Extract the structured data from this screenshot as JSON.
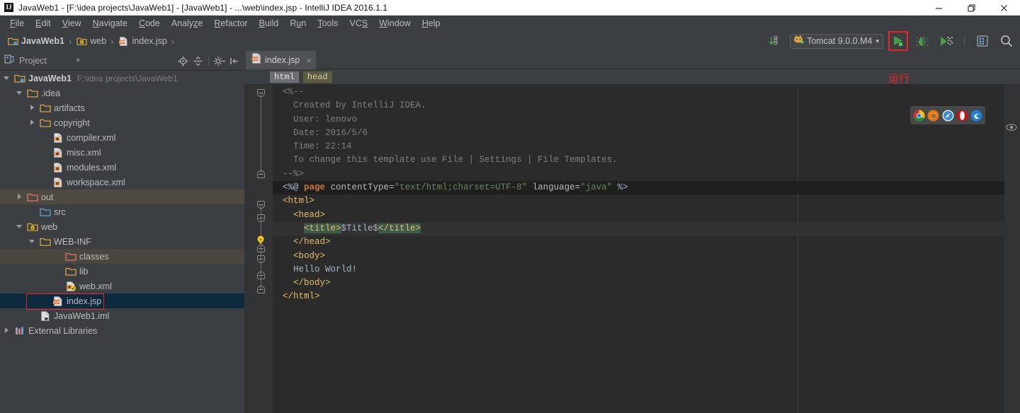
{
  "window": {
    "title": "JavaWeb1 - [F:\\idea projects\\JavaWeb1] - [JavaWeb1] - ...\\web\\index.jsp - IntelliJ IDEA 2016.1.1",
    "logo_text": "IJ",
    "minimize_label": "—",
    "maximize_label": "❐",
    "close_label": "✕"
  },
  "menubar": {
    "items": [
      {
        "label": "File",
        "mnemonic": "F"
      },
      {
        "label": "Edit",
        "mnemonic": "E"
      },
      {
        "label": "View",
        "mnemonic": "V"
      },
      {
        "label": "Navigate",
        "mnemonic": "N"
      },
      {
        "label": "Code",
        "mnemonic": "C"
      },
      {
        "label": "Analyze",
        "mnemonic": "z"
      },
      {
        "label": "Refactor",
        "mnemonic": "R"
      },
      {
        "label": "Build",
        "mnemonic": "B"
      },
      {
        "label": "Run",
        "mnemonic": "u"
      },
      {
        "label": "Tools",
        "mnemonic": "T"
      },
      {
        "label": "VCS",
        "mnemonic": "S"
      },
      {
        "label": "Window",
        "mnemonic": "W"
      },
      {
        "label": "Help",
        "mnemonic": "H"
      }
    ]
  },
  "navbar": {
    "breadcrumbs": [
      {
        "label": "JavaWeb1",
        "icon": "module-icon"
      },
      {
        "label": "web",
        "icon": "web-folder-icon"
      },
      {
        "label": "index.jsp",
        "icon": "jsp-file-icon"
      }
    ],
    "separator": "›",
    "run_config": "Tomcat 9.0.0.M4",
    "run_config_icon": "tomcat-icon",
    "dropdown_arrow": "▾",
    "buttons": [
      {
        "name": "update-running-application-icon",
        "label": ""
      },
      {
        "name": "run-button",
        "label": "Run"
      },
      {
        "name": "debug-button",
        "label": "Debug"
      },
      {
        "name": "run-with-coverage-button",
        "label": "Run with Coverage"
      },
      {
        "name": "search-everywhere-button",
        "label": "Search"
      },
      {
        "name": "settings-button",
        "label": "Settings"
      }
    ]
  },
  "project_panel": {
    "title": "Project",
    "dropdown_arrow": "▾",
    "tools": [
      {
        "name": "locate-file-icon"
      },
      {
        "name": "collapse-all-icon"
      },
      {
        "name": "panel-settings-icon"
      },
      {
        "name": "hide-panel-icon"
      }
    ],
    "tree": [
      {
        "label": "JavaWeb1",
        "path": "F:\\idea projects\\JavaWeb1",
        "indent": 0,
        "arrow": "down",
        "icon": "module-icon",
        "bold": true
      },
      {
        "label": ".idea",
        "path": "",
        "indent": 1,
        "arrow": "down",
        "icon": "folder-icon"
      },
      {
        "label": "artifacts",
        "path": "",
        "indent": 2,
        "arrow": "right",
        "icon": "folder-icon"
      },
      {
        "label": "copyright",
        "path": "",
        "indent": 2,
        "arrow": "right",
        "icon": "folder-icon"
      },
      {
        "label": "compiler.xml",
        "path": "",
        "indent": 3,
        "arrow": "none",
        "icon": "xml-file-icon"
      },
      {
        "label": "misc.xml",
        "path": "",
        "indent": 3,
        "arrow": "none",
        "icon": "xml-file-icon"
      },
      {
        "label": "modules.xml",
        "path": "",
        "indent": 3,
        "arrow": "none",
        "icon": "xml-file-icon"
      },
      {
        "label": "workspace.xml",
        "path": "",
        "indent": 3,
        "arrow": "none",
        "icon": "xml-file-icon"
      },
      {
        "label": "out",
        "path": "",
        "indent": 1,
        "arrow": "right",
        "icon": "excluded-folder-icon",
        "row_style": "hl-out"
      },
      {
        "label": "src",
        "path": "",
        "indent": 2,
        "arrow": "none",
        "icon": "source-folder-icon"
      },
      {
        "label": "web",
        "path": "",
        "indent": 1,
        "arrow": "down",
        "icon": "web-folder-icon"
      },
      {
        "label": "WEB-INF",
        "path": "",
        "indent": 2,
        "arrow": "down",
        "icon": "folder-icon"
      },
      {
        "label": "classes",
        "path": "",
        "indent": 4,
        "arrow": "none",
        "icon": "excluded-folder-icon",
        "row_style": "hl-classes"
      },
      {
        "label": "lib",
        "path": "",
        "indent": 4,
        "arrow": "none",
        "icon": "folder-icon"
      },
      {
        "label": "web.xml",
        "path": "",
        "indent": 4,
        "arrow": "none",
        "icon": "web-xml-icon"
      },
      {
        "label": "index.jsp",
        "path": "",
        "indent": 3,
        "arrow": "none",
        "icon": "jsp-file-icon",
        "row_style": "sel",
        "boxed": true
      },
      {
        "label": "JavaWeb1.iml",
        "path": "",
        "indent": 2,
        "arrow": "none",
        "icon": "iml-file-icon"
      },
      {
        "label": "External Libraries",
        "path": "",
        "indent": 0,
        "arrow": "right",
        "icon": "libraries-icon"
      }
    ]
  },
  "editor": {
    "tab": {
      "label": "index.jsp",
      "icon": "jsp-file-icon",
      "close": "×"
    },
    "breadcrumb_tags": [
      {
        "label": "html",
        "style": "sel"
      },
      {
        "label": "head",
        "style": "alt"
      }
    ],
    "eye_icon": "preview-eye-icon",
    "lines": [
      {
        "id": "l1",
        "segments": [
          {
            "text": "<%--",
            "cls": "cmt"
          }
        ]
      },
      {
        "id": "l2",
        "segments": [
          {
            "text": "  Created by IntelliJ IDEA.",
            "cls": "cmt"
          }
        ]
      },
      {
        "id": "l3",
        "segments": [
          {
            "text": "  User: lenovo",
            "cls": "cmt"
          }
        ]
      },
      {
        "id": "l4",
        "segments": [
          {
            "text": "  Date: 2016/5/6",
            "cls": "cmt"
          }
        ]
      },
      {
        "id": "l5",
        "segments": [
          {
            "text": "  Time: 22:14",
            "cls": "cmt"
          }
        ]
      },
      {
        "id": "l6",
        "segments": [
          {
            "text": "  To change this template use File | Settings | File Templates.",
            "cls": "cmt"
          }
        ]
      },
      {
        "id": "l7",
        "segments": [
          {
            "text": "--%>",
            "cls": "cmt"
          }
        ]
      },
      {
        "id": "l8",
        "cls": "pagebg",
        "segments": [
          {
            "text": "<%@ ",
            "cls": "txt"
          },
          {
            "text": "page",
            "cls": "kw"
          },
          {
            "text": " contentType=",
            "cls": "attr"
          },
          {
            "text": "\"text/html;charset=UTF-8\"",
            "cls": "str"
          },
          {
            "text": " language=",
            "cls": "attr"
          },
          {
            "text": "\"java\"",
            "cls": "str"
          },
          {
            "text": " %>",
            "cls": "txt"
          }
        ]
      },
      {
        "id": "l9",
        "segments": [
          {
            "text": "<html>",
            "cls": "tag"
          }
        ]
      },
      {
        "id": "l10",
        "segments": [
          {
            "text": "  <head>",
            "cls": "tag"
          }
        ]
      },
      {
        "id": "l11",
        "cls": "hlline",
        "segments": [
          {
            "text": "    ",
            "cls": "txt"
          },
          {
            "text": "<title>",
            "cls": "tag titlehl"
          },
          {
            "text": "$Title$",
            "cls": "txt"
          },
          {
            "text": "</title>",
            "cls": "tag titlehl"
          }
        ]
      },
      {
        "id": "l12",
        "segments": [
          {
            "text": "  </head>",
            "cls": "tag"
          }
        ]
      },
      {
        "id": "l13",
        "segments": [
          {
            "text": "  <body>",
            "cls": "tag"
          }
        ]
      },
      {
        "id": "l14",
        "segments": [
          {
            "text": "  Hello World!",
            "cls": "txt"
          }
        ]
      },
      {
        "id": "l15",
        "segments": [
          {
            "text": "  </body>",
            "cls": "tag"
          }
        ]
      },
      {
        "id": "l16",
        "segments": [
          {
            "text": "</html>",
            "cls": "tag"
          }
        ]
      }
    ],
    "intention_bulb": "intention-lightbulb-icon"
  },
  "annotations": {
    "run_label": "运行"
  },
  "browser_bar": {
    "browsers": [
      {
        "name": "chrome-icon",
        "color": "#4caf50"
      },
      {
        "name": "firefox-icon",
        "color": "#e8701a"
      },
      {
        "name": "safari-icon",
        "color": "#3a7bd5"
      },
      {
        "name": "opera-icon",
        "color": "#cc0f16"
      },
      {
        "name": "edge-icon",
        "color": "#2a7de1"
      }
    ]
  },
  "colors": {
    "titlebar_bg": "#ffffff",
    "chrome_bg": "#3c3f41",
    "editor_bg": "#2b2b2b",
    "gutter_bg": "#313335",
    "selection_bg": "#0d293e",
    "highlight_red": "#e8262a",
    "run_green": "#389c38"
  }
}
